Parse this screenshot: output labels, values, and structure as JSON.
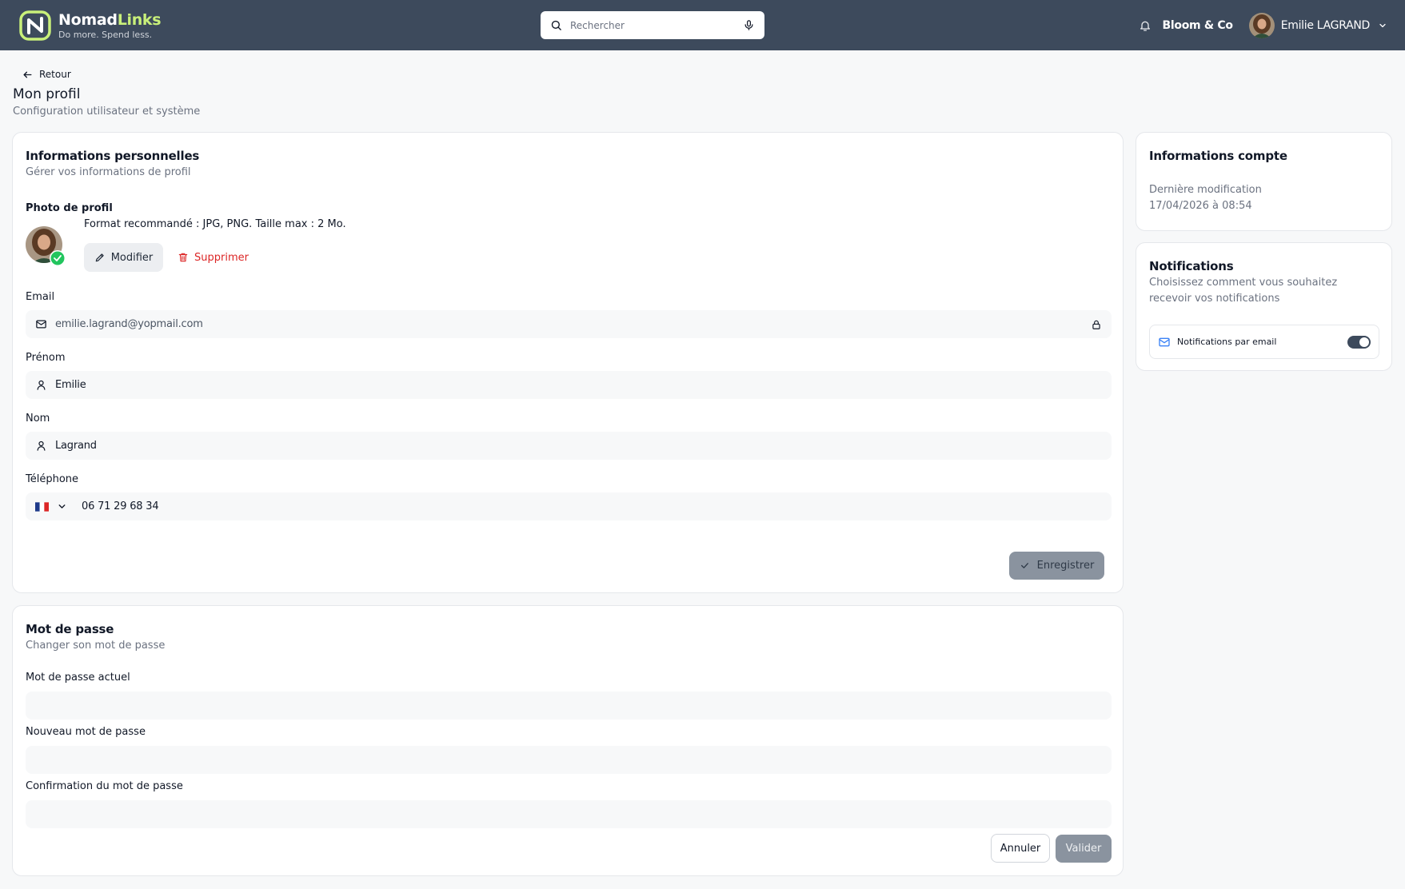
{
  "header": {
    "brand_name_part1": "Nomad",
    "brand_name_part2": "Links",
    "brand_tagline": "Do more. Spend less.",
    "search_placeholder": "Rechercher",
    "company": "Bloom & Co",
    "user_name": "Emilie LAGRAND",
    "icons": [
      "search-icon",
      "microphone-icon",
      "bell-icon",
      "chevron-down-icon"
    ]
  },
  "page": {
    "back_label": "Retour",
    "title": "Mon profil",
    "subtitle": "Configuration utilisateur et système"
  },
  "personal": {
    "title": "Informations personnelles",
    "subtitle": "Gérer vos informations de profil",
    "photo_label": "Photo de profil",
    "photo_hint": "Format recommandé : JPG, PNG. Taille max : 2 Mo.",
    "modify_label": "Modifier",
    "delete_label": "Supprimer",
    "email_label": "Email",
    "email_value": "emilie.lagrand@yopmail.com",
    "firstname_label": "Prénom",
    "firstname_value": "Emilie",
    "lastname_label": "Nom",
    "lastname_value": "Lagrand",
    "phone_label": "Téléphone",
    "phone_value": "06 71 29 68 34",
    "save_label": "Enregistrer"
  },
  "password": {
    "title": "Mot de passe",
    "subtitle": "Changer son mot de passe",
    "current_label": "Mot de passe actuel",
    "new_label": "Nouveau mot de passe",
    "confirm_label": "Confirmation du mot de passe",
    "cancel_label": "Annuler",
    "validate_label": "Valider"
  },
  "account": {
    "title": "Informations compte",
    "last_modified_label": "Dernière modification",
    "last_modified_value": "17/04/2026 à 08:54"
  },
  "notifications": {
    "title": "Notifications",
    "subtitle": "Choisissez comment vous souhaitez recevoir vos notifications",
    "email_toggle_label": "Notifications par email",
    "email_toggle_on": true
  },
  "colors": {
    "topbar": "#3d4a5c",
    "brand_accent": "#c9f07a",
    "danger": "#dc2626",
    "disabled_button": "#8a939f",
    "success": "#22c55e",
    "mail_icon": "#3b82f6"
  }
}
